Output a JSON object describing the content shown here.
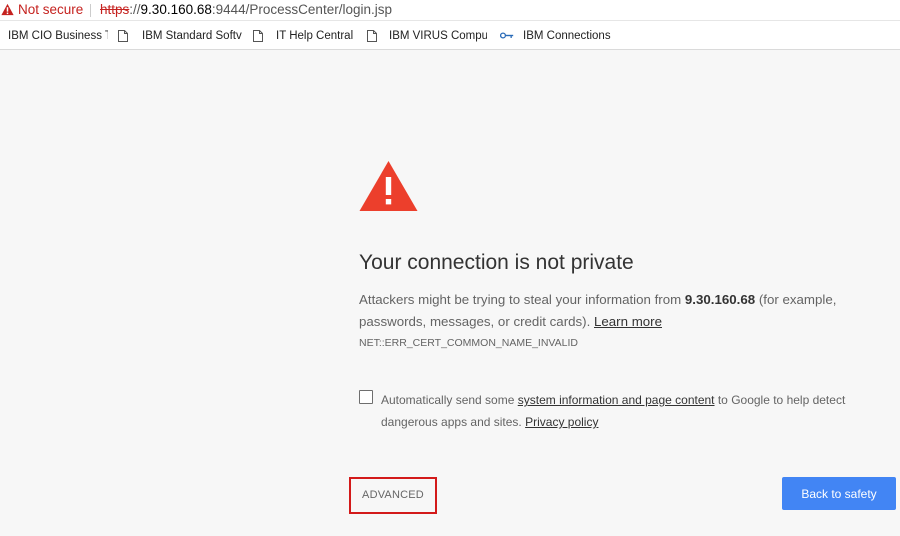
{
  "address_bar": {
    "security_label": "Not secure",
    "url_scheme": "https",
    "url_separator": "://",
    "url_host": "9.30.160.68",
    "url_rest": ":9444/ProcessCenter/login.jsp",
    "warning_icon": "warning-triangle-icon"
  },
  "bookmarks": [
    {
      "label": "IBM CIO Business T",
      "icon": "none"
    },
    {
      "label": "IBM Standard Softv",
      "icon": "page-icon"
    },
    {
      "label": "IT Help Central",
      "icon": "page-icon"
    },
    {
      "label": "IBM VIRUS Compu",
      "icon": "page-icon"
    },
    {
      "label": "IBM Connections",
      "icon": "key-icon"
    }
  ],
  "interstitial": {
    "heading": "Your connection is not private",
    "message_before": "Attackers might be trying to steal your information from ",
    "host": "9.30.160.68",
    "message_after": " (for example, passwords, messages, or credit cards). ",
    "learn_more": "Learn more",
    "error_code": "NET::ERR_CERT_COMMON_NAME_INVALID",
    "optin_before": "Automatically send some ",
    "optin_link": "system information and page content",
    "optin_middle": " to Google to help detect dangerous apps and sites. ",
    "privacy_link": "Privacy policy",
    "optin_checked": false,
    "advanced_label": "ADVANCED",
    "back_label": "Back to safety"
  },
  "colors": {
    "error_red": "#c5221f",
    "icon_red": "#ec3f2c",
    "primary_blue": "#4285f4",
    "highlight_box": "#d31a1a",
    "page_background": "#f7f7f7"
  }
}
